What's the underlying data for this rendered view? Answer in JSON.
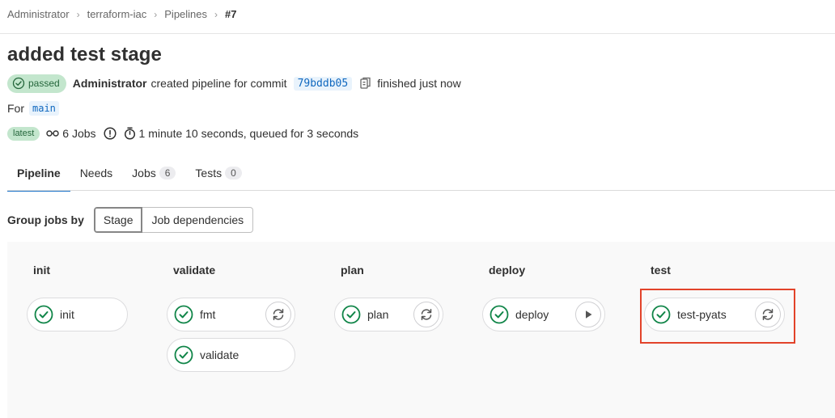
{
  "breadcrumb": [
    "Administrator",
    "terraform-iac",
    "Pipelines",
    "#7"
  ],
  "title": "added test stage",
  "status": {
    "badge": "passed",
    "user": "Administrator",
    "created_text": "created pipeline for commit",
    "commit": "79bddb05",
    "finished": "finished just now"
  },
  "branch": {
    "prefix": "For",
    "name": "main"
  },
  "meta": {
    "latest": "latest",
    "jobs": "6 Jobs",
    "duration": "1 minute 10 seconds, queued for 3 seconds"
  },
  "tabs": [
    {
      "label": "Pipeline"
    },
    {
      "label": "Needs"
    },
    {
      "label": "Jobs",
      "count": "6"
    },
    {
      "label": "Tests",
      "count": "0"
    }
  ],
  "group": {
    "label": "Group jobs by",
    "options": [
      "Stage",
      "Job dependencies"
    ],
    "selected": "Stage"
  },
  "stages": [
    {
      "name": "init",
      "jobs": [
        {
          "name": "init",
          "status": "success",
          "action": ""
        }
      ]
    },
    {
      "name": "validate",
      "jobs": [
        {
          "name": "fmt",
          "status": "success",
          "action": "retry"
        },
        {
          "name": "validate",
          "status": "success",
          "action": ""
        }
      ]
    },
    {
      "name": "plan",
      "jobs": [
        {
          "name": "plan",
          "status": "success",
          "action": "retry"
        }
      ]
    },
    {
      "name": "deploy",
      "jobs": [
        {
          "name": "deploy",
          "status": "success",
          "action": "play"
        }
      ]
    },
    {
      "name": "test",
      "jobs": [
        {
          "name": "test-pyats",
          "status": "success",
          "action": "retry"
        }
      ]
    }
  ],
  "colors": {
    "success": "#108548",
    "highlight": "#e2432a",
    "link": "#1068bf",
    "active_tab": "#1f75cb"
  }
}
